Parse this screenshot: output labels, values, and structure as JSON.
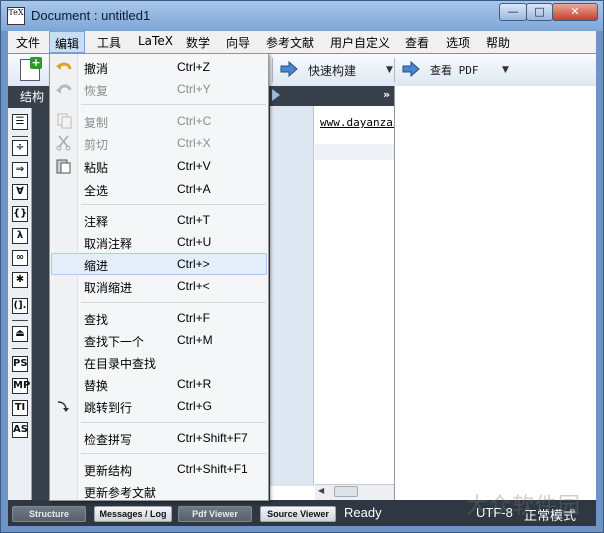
{
  "window": {
    "title": "Document : untitled1",
    "app_icon_text": "TeX",
    "controls": {
      "minimize": "—",
      "maximize": "□",
      "close": "✕"
    }
  },
  "menubar": {
    "items": [
      {
        "label": "文件"
      },
      {
        "label": "编辑"
      },
      {
        "label": "工具"
      },
      {
        "label": "LaTeX"
      },
      {
        "label": "数学"
      },
      {
        "label": "向导"
      },
      {
        "label": "参考文献"
      },
      {
        "label": "用户自定义"
      },
      {
        "label": "查看"
      },
      {
        "label": "选项"
      },
      {
        "label": "帮助"
      }
    ]
  },
  "toolbar": {
    "build_label": "快速构建",
    "view_label": "查看 PDF",
    "dropdown_glyph": "▼"
  },
  "left_panel": {
    "tab_label": "结构",
    "sidebar_icons": [
      {
        "name": "structure-icon",
        "glyph": "☰"
      },
      {
        "name": "relation-icon",
        "glyph": "÷"
      },
      {
        "name": "arrows-icon",
        "glyph": "⇒"
      },
      {
        "name": "misc-math-icon",
        "glyph": "∀"
      },
      {
        "name": "delimiters-icon",
        "glyph": "{}"
      },
      {
        "name": "greek-icon",
        "glyph": "λ"
      },
      {
        "name": "infinity-icon",
        "glyph": "∞"
      },
      {
        "name": "asterisk-icon",
        "glyph": "✱"
      },
      {
        "name": "brackets-icon",
        "glyph": "(]."
      },
      {
        "name": "user-icon",
        "glyph": "⏏"
      },
      {
        "name": "pstricks-icon",
        "glyph": "PS"
      },
      {
        "name": "metapost-icon",
        "glyph": "MP"
      },
      {
        "name": "tikz-icon",
        "glyph": "TI"
      },
      {
        "name": "asymptote-icon",
        "glyph": "AS"
      }
    ]
  },
  "editor": {
    "more_glyph": "»",
    "code_text": "www.dayanzai.me"
  },
  "edit_menu": {
    "items": [
      {
        "type": "item",
        "label": "撤消",
        "shortcut": "Ctrl+Z",
        "disabled": false,
        "icon": "undo-icon"
      },
      {
        "type": "item",
        "label": "恢复",
        "shortcut": "Ctrl+Y",
        "disabled": true,
        "icon": "redo-icon"
      },
      {
        "type": "sep"
      },
      {
        "type": "item",
        "label": "复制",
        "shortcut": "Ctrl+C",
        "disabled": true,
        "icon": "copy-icon"
      },
      {
        "type": "item",
        "label": "剪切",
        "shortcut": "Ctrl+X",
        "disabled": true,
        "icon": "cut-icon"
      },
      {
        "type": "item",
        "label": "粘贴",
        "shortcut": "Ctrl+V",
        "disabled": false,
        "icon": "paste-icon"
      },
      {
        "type": "item",
        "label": "全选",
        "shortcut": "Ctrl+A",
        "disabled": false,
        "icon": ""
      },
      {
        "type": "sep"
      },
      {
        "type": "item",
        "label": "注释",
        "shortcut": "Ctrl+T",
        "disabled": false,
        "icon": ""
      },
      {
        "type": "item",
        "label": "取消注释",
        "shortcut": "Ctrl+U",
        "disabled": false,
        "icon": ""
      },
      {
        "type": "item",
        "label": "缩进",
        "shortcut": "Ctrl+>",
        "disabled": false,
        "icon": "",
        "highlighted": true
      },
      {
        "type": "item",
        "label": "取消缩进",
        "shortcut": "Ctrl+<",
        "disabled": false,
        "icon": ""
      },
      {
        "type": "sep"
      },
      {
        "type": "item",
        "label": "查找",
        "shortcut": "Ctrl+F",
        "disabled": false,
        "icon": ""
      },
      {
        "type": "item",
        "label": "查找下一个",
        "shortcut": "Ctrl+M",
        "disabled": false,
        "icon": ""
      },
      {
        "type": "item",
        "label": "在目录中查找",
        "shortcut": "",
        "disabled": false,
        "icon": ""
      },
      {
        "type": "item",
        "label": "替换",
        "shortcut": "Ctrl+R",
        "disabled": false,
        "icon": ""
      },
      {
        "type": "item",
        "label": "跳转到行",
        "shortcut": "Ctrl+G",
        "disabled": false,
        "icon": "goto-line-icon"
      },
      {
        "type": "sep"
      },
      {
        "type": "item",
        "label": "检查拼写",
        "shortcut": "Ctrl+Shift+F7",
        "disabled": false,
        "icon": ""
      },
      {
        "type": "sep"
      },
      {
        "type": "item",
        "label": "更新结构",
        "shortcut": "Ctrl+Shift+F1",
        "disabled": false,
        "icon": ""
      },
      {
        "type": "item",
        "label": "更新参考文献",
        "shortcut": "",
        "disabled": false,
        "icon": ""
      }
    ]
  },
  "statusbar": {
    "buttons": [
      {
        "label": "Structure",
        "dim": true
      },
      {
        "label": "Messages / Log",
        "dim": false
      },
      {
        "label": "Pdf Viewer",
        "dim": true
      },
      {
        "label": "Source Viewer",
        "dim": false
      }
    ],
    "ready": "Ready",
    "encoding": "UTF-8",
    "mode": "正常模式"
  },
  "watermark": "大众软件园",
  "colors": {
    "menu_highlight": "#e4eefa",
    "panel_dark": "#38404b",
    "titlebar": "#7ea6d6"
  }
}
